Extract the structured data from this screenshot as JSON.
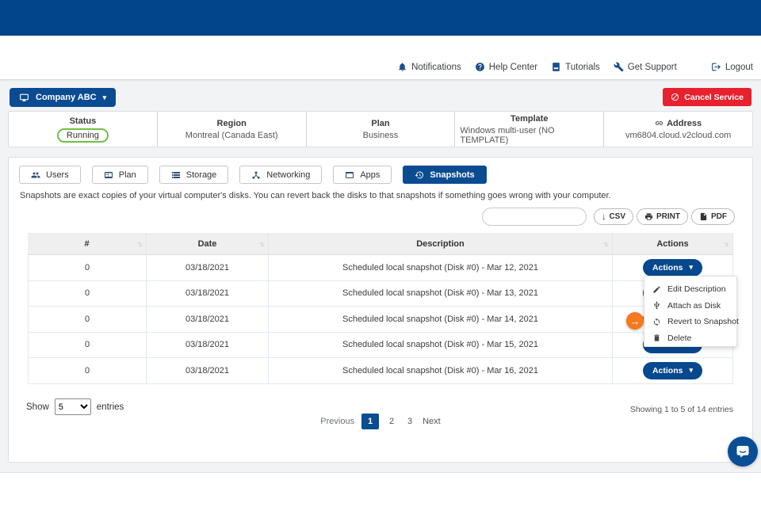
{
  "nav": {
    "items": [
      {
        "icon": "bell-icon",
        "label": "Notifications"
      },
      {
        "icon": "help-circle-icon",
        "label": "Help Center"
      },
      {
        "icon": "book-icon",
        "label": "Tutorials"
      },
      {
        "icon": "wrench-icon",
        "label": "Get Support"
      },
      {
        "icon": "logout-icon",
        "label": "Logout"
      }
    ]
  },
  "toolbar": {
    "company_label": "Company ABC",
    "cancel_label": "Cancel Service"
  },
  "status_card": {
    "items": [
      {
        "label": "Status",
        "value": "Running"
      },
      {
        "label": "Region",
        "value": "Montreal (Canada East)"
      },
      {
        "label": "Plan",
        "value": "Business"
      },
      {
        "label": "Template",
        "value": "Windows multi-user (NO TEMPLATE)"
      },
      {
        "label": "Address",
        "value": "vm6804.cloud.v2cloud.com",
        "icon": "link-icon"
      }
    ]
  },
  "tabs": [
    {
      "icon": "users-icon",
      "label": "Users"
    },
    {
      "icon": "plan-icon",
      "label": "Plan"
    },
    {
      "icon": "storage-icon",
      "label": "Storage"
    },
    {
      "icon": "network-icon",
      "label": "Networking"
    },
    {
      "icon": "apps-icon",
      "label": "Apps"
    },
    {
      "icon": "history-icon",
      "label": "Snapshots",
      "active": true
    }
  ],
  "snapshots": {
    "description": "Snapshots are exact copies of your virtual computer's disks. You can revert back the disks to that snapshots if something goes wrong with your computer.",
    "search_value": "",
    "export_buttons": [
      {
        "icon": "download-icon",
        "label": "CSV"
      },
      {
        "icon": "printer-icon",
        "label": "PRINT"
      },
      {
        "icon": "file-icon",
        "label": "PDF"
      }
    ]
  },
  "table": {
    "columns": [
      "#",
      "Date",
      "Description",
      "Actions"
    ],
    "action_button_label": "Actions",
    "rows": [
      {
        "num": "0",
        "date": "03/18/2021",
        "description": "Scheduled local snapshot (Disk #0) - Mar 12, 2021"
      },
      {
        "num": "0",
        "date": "03/18/2021",
        "description": "Scheduled local snapshot (Disk #0) - Mar 13, 2021"
      },
      {
        "num": "0",
        "date": "03/18/2021",
        "description": "Scheduled local snapshot (Disk #0) - Mar 14, 2021"
      },
      {
        "num": "0",
        "date": "03/18/2021",
        "description": "Scheduled local snapshot (Disk #0) - Mar 15, 2021"
      },
      {
        "num": "0",
        "date": "03/18/2021",
        "description": "Scheduled local snapshot (Disk #0) - Mar 16, 2021"
      }
    ]
  },
  "action_menu": {
    "items": [
      {
        "icon": "pencil-icon",
        "label": "Edit Description"
      },
      {
        "icon": "usb-icon",
        "label": "Attach as Disk"
      },
      {
        "icon": "sync-icon",
        "label": "Revert to Snapshot"
      },
      {
        "icon": "trash-icon",
        "label": "Delete"
      }
    ]
  },
  "footer": {
    "show_label": "Show",
    "page_size": "5",
    "entries_label": "entries",
    "previous": "Previous",
    "pages": [
      "1",
      "2",
      "3"
    ],
    "active_page": "1",
    "next": "Next",
    "showing_text": "Showing 1 to 5 of 14 entries"
  },
  "colors": {
    "topbar": "#02458a",
    "primary": "#0b4b92",
    "danger": "#e8212e",
    "success": "#72bf44",
    "accent_orange": "#f4791f"
  }
}
